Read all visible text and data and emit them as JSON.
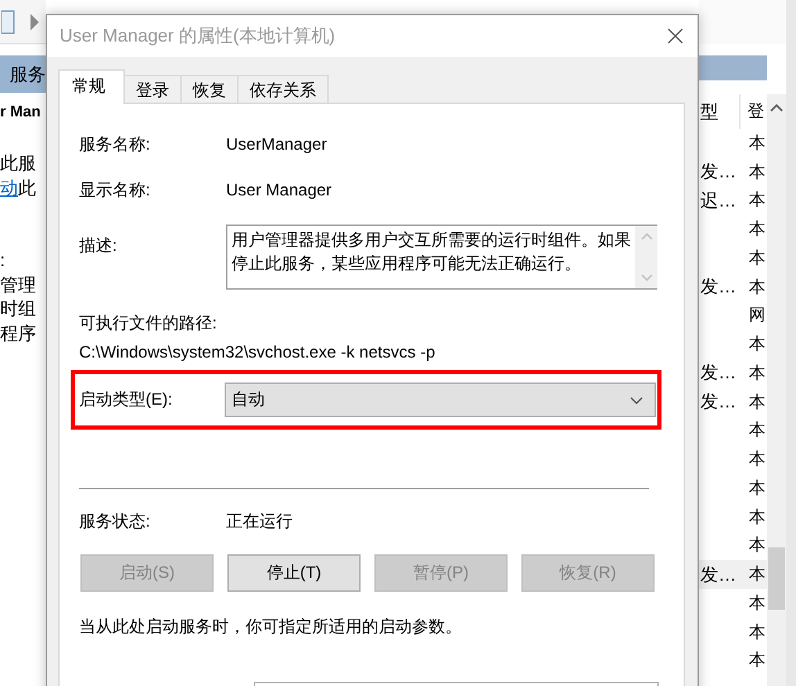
{
  "background_window": {
    "left_pane": {
      "header": "服务",
      "service_name": "r Man",
      "action_lines": [
        {
          "text": "此服"
        },
        {
          "link": "动",
          "text": "此"
        }
      ],
      "description_lines": [
        ":",
        "管理",
        "时组",
        "程序"
      ]
    },
    "right_pane": {
      "columns": [
        "型",
        "登"
      ],
      "rows": [
        {
          "login": "本",
          "selected": false
        },
        {
          "type": "发…",
          "login": "本",
          "selected": false
        },
        {
          "type": "迟…",
          "login": "本",
          "selected": false
        },
        {
          "login": "本",
          "selected": false
        },
        {
          "login": "本",
          "selected": false
        },
        {
          "type": "发…",
          "login": "本",
          "selected": false
        },
        {
          "login": "网",
          "selected": false
        },
        {
          "login": "本",
          "selected": false
        },
        {
          "type": "发…",
          "login": "本",
          "selected": false
        },
        {
          "type": "发…",
          "login": "本",
          "selected": false
        },
        {
          "login": "本",
          "selected": false
        },
        {
          "login": "本",
          "selected": false
        },
        {
          "login": "本",
          "selected": false
        },
        {
          "login": "本",
          "selected": false
        },
        {
          "login": "本",
          "selected": false
        },
        {
          "type": "发…",
          "login": "本",
          "selected": true
        },
        {
          "login": "本",
          "selected": false
        },
        {
          "login": "本",
          "selected": false
        },
        {
          "login": "本",
          "selected": false
        }
      ]
    }
  },
  "dialog": {
    "title": "User Manager 的属性(本地计算机)",
    "tabs": [
      {
        "label": "常规",
        "selected": true
      },
      {
        "label": "登录",
        "selected": false
      },
      {
        "label": "恢复",
        "selected": false
      },
      {
        "label": "依存关系",
        "selected": false
      }
    ],
    "fields": [
      {
        "label": "服务名称:",
        "value": "UserManager"
      },
      {
        "label": "显示名称:",
        "value": "User Manager"
      }
    ],
    "description": {
      "label": "描述:",
      "text": "用户管理器提供多用户交互所需要的运行时组件。如果停止此服务，某些应用程序可能无法正确运行。"
    },
    "path": {
      "label": "可执行文件的路径:",
      "value": "C:\\Windows\\system32\\svchost.exe -k netsvcs -p"
    },
    "startup_type": {
      "label": "启动类型(E):",
      "value": "自动",
      "highlighted": true
    },
    "status": {
      "label": "服务状态:",
      "value": "正在运行"
    },
    "buttons": [
      {
        "label": "启动(S)",
        "disabled": true
      },
      {
        "label": "停止(T)",
        "disabled": false
      },
      {
        "label": "暂停(P)",
        "disabled": true
      },
      {
        "label": "恢复(R)",
        "disabled": true
      }
    ],
    "hint": "当从此处启动服务时，你可指定所适用的启动参数。"
  }
}
